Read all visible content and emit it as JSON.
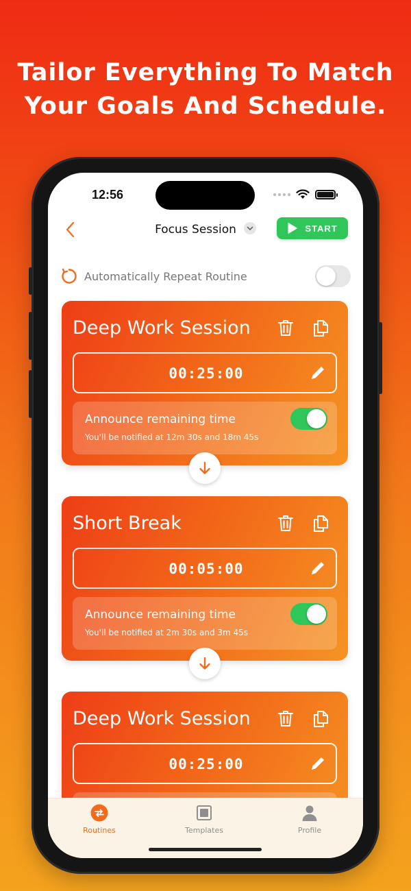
{
  "headline": {
    "line1": "Tailor Everything To Match",
    "line2": "Your Goals And Schedule."
  },
  "status_bar": {
    "time": "12:56"
  },
  "nav": {
    "title": "Focus Session",
    "start_label": "START"
  },
  "repeat": {
    "label": "Automatically Repeat Routine",
    "enabled": false
  },
  "cards": [
    {
      "title": "Deep Work Session",
      "duration": "00:25:00",
      "announce_label": "Announce remaining time",
      "announce_sub": "You'll be notified at 12m 30s and 18m 45s",
      "announce_enabled": true
    },
    {
      "title": "Short Break",
      "duration": "00:05:00",
      "announce_label": "Announce remaining time",
      "announce_sub": "You'll be notified at 2m 30s and 3m 45s",
      "announce_enabled": true
    },
    {
      "title": "Deep Work Session",
      "duration": "00:25:00",
      "announce_label": "",
      "announce_sub": "",
      "announce_enabled": true
    }
  ],
  "tabs": [
    {
      "label": "Routines",
      "icon": "routines-icon",
      "active": true
    },
    {
      "label": "Templates",
      "icon": "templates-icon",
      "active": false
    },
    {
      "label": "Profile",
      "icon": "profile-icon",
      "active": false
    }
  ],
  "colors": {
    "accent": "#f26a1b",
    "start_green": "#2fc65a",
    "tab_active": "#f26a1b",
    "tab_inactive": "#8f8f8f"
  }
}
